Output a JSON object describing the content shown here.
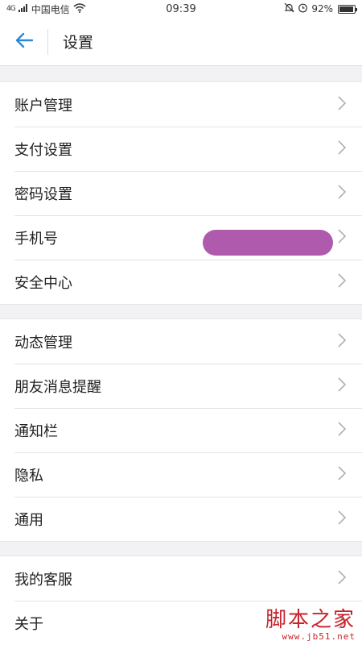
{
  "status_bar": {
    "carrier": "中国电信",
    "network": "4G",
    "time": "09:39",
    "battery": "92%",
    "battery_level": 0.92
  },
  "header": {
    "title": "设置"
  },
  "groups": [
    {
      "items": [
        {
          "label": "账户管理"
        },
        {
          "label": "支付设置"
        },
        {
          "label": "密码设置"
        },
        {
          "label": "手机号"
        },
        {
          "label": "安全中心"
        }
      ]
    },
    {
      "items": [
        {
          "label": "动态管理"
        },
        {
          "label": "朋友消息提醒"
        },
        {
          "label": "通知栏"
        },
        {
          "label": "隐私"
        },
        {
          "label": "通用"
        }
      ]
    },
    {
      "items": [
        {
          "label": "我的客服"
        },
        {
          "label": "关于"
        }
      ]
    }
  ],
  "watermark": {
    "main": "脚本之家",
    "sub": "www.jb51.net"
  },
  "colors": {
    "accent": "#2a8ad8",
    "redaction": "#b05aae",
    "watermark": "#c8232c"
  }
}
